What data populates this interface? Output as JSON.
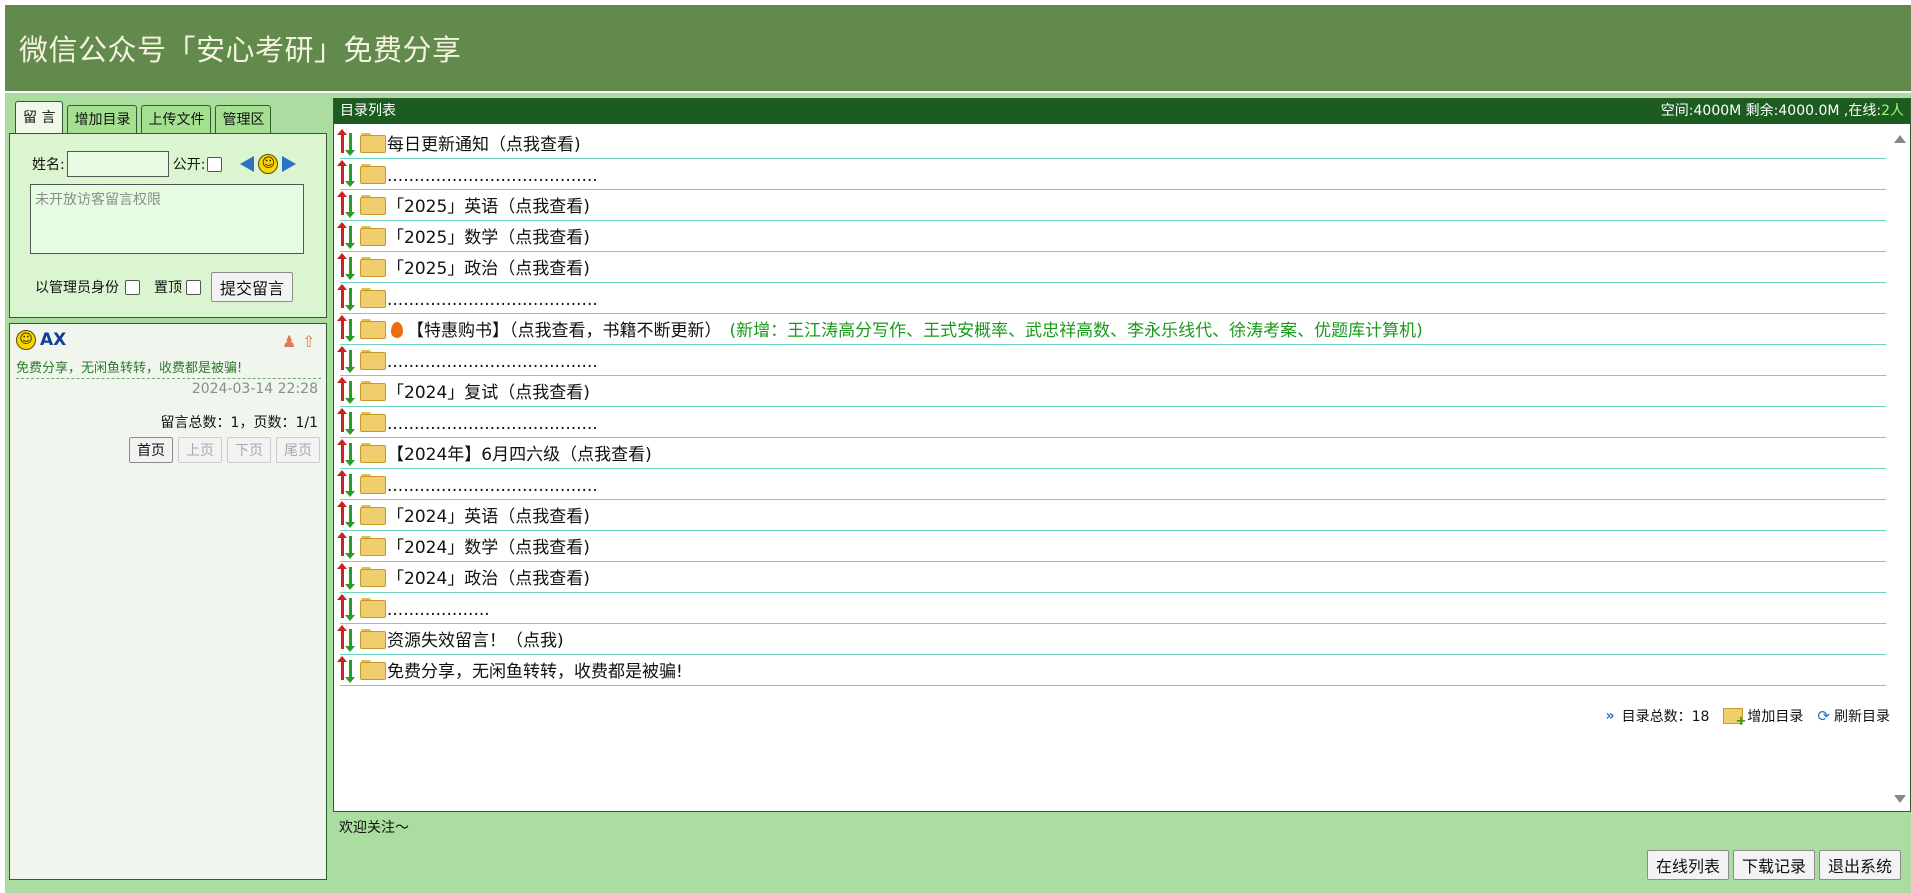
{
  "header": {
    "title": "微信公众号「安心考研」免费分享"
  },
  "left": {
    "tabs": [
      "留 言",
      "增加目录",
      "上传文件",
      "管理区"
    ],
    "form": {
      "name_label": "姓名:",
      "public_label": "公开:",
      "message_placeholder": "未开放访客留言权限",
      "admin_label": "以管理员身份",
      "pin_label": "置顶",
      "submit_label": "提交留言"
    },
    "message": {
      "user": "AX",
      "text": "免费分享，无闲鱼转转，收费都是被骗!",
      "date": "2024-03-14 22:28"
    },
    "count_text": "留言总数：1，页数：1/1",
    "pager": [
      "首页",
      "上页",
      "下页",
      "尾页"
    ]
  },
  "list": {
    "title": "目录列表",
    "space_text": "空间:4000M 剩余:4000.0M ,在线:",
    "online": "2人",
    "rows": [
      {
        "name": "每日更新通知（点我查看)"
      },
      {
        "name": "......................................."
      },
      {
        "name": "「2025」英语（点我查看)"
      },
      {
        "name": "「2025」数学（点我查看)"
      },
      {
        "name": "「2025」政治（点我查看)"
      },
      {
        "name": "......................................."
      },
      {
        "name": "【特惠购书】（点我查看，书籍不断更新）",
        "extra": "(新增：王江涛高分写作、王式安概率、武忠祥高数、李永乐线代、徐涛考案、优题库计算机)"
      },
      {
        "name": "......................................."
      },
      {
        "name": "「2024」复试（点我查看)"
      },
      {
        "name": "......................................."
      },
      {
        "name": "【2024年】6月四六级（点我查看)"
      },
      {
        "name": "......................................."
      },
      {
        "name": "「2024」英语（点我查看)"
      },
      {
        "name": "「2024」数学（点我查看)"
      },
      {
        "name": "「2024」政治（点我查看)"
      },
      {
        "name": "..................."
      },
      {
        "name": "资源失效留言！（点我)"
      },
      {
        "name": "免费分享，无闲鱼转转，收费都是被骗!"
      }
    ],
    "total_text": "目录总数：18",
    "add_label": "增加目录",
    "refresh_label": "刷新目录"
  },
  "footer": {
    "welcome": "欢迎关注～",
    "buttons": [
      "在线列表",
      "下载记录",
      "退出系统"
    ]
  }
}
